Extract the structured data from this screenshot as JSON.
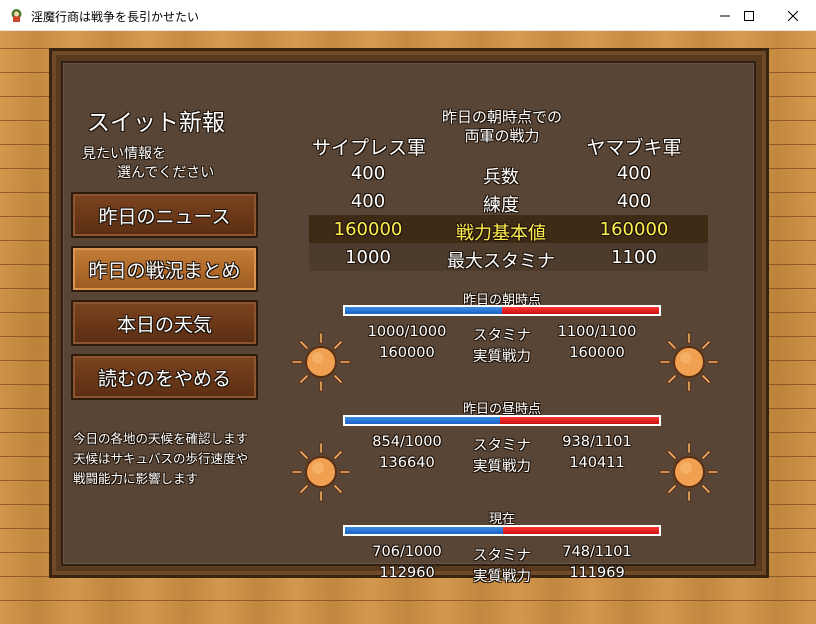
{
  "window": {
    "title": "淫魔行商は戦争を長引かせたい",
    "icon": "app-icon"
  },
  "panel": {
    "title": "スイット新報",
    "hint_line1": "見たい情報を",
    "hint_line2": "選んでください"
  },
  "menu": [
    {
      "label": "昨日のニュース",
      "active": false
    },
    {
      "label": "昨日の戦況まとめ",
      "active": true
    },
    {
      "label": "本日の天気",
      "active": false
    },
    {
      "label": "読むのをやめる",
      "active": false
    }
  ],
  "description": [
    "今日の各地の天候を確認します",
    "天候はサキュバスの歩行速度や",
    "戦闘能力に影響します"
  ],
  "comparison": {
    "header_line1": "昨日の朝時点での",
    "header_line2": "両軍の戦力",
    "left_army": "サイプレス軍",
    "right_army": "ヤマブキ軍",
    "rows": [
      {
        "label": "兵数",
        "left": "400",
        "right": "400",
        "highlight": false
      },
      {
        "label": "練度",
        "left": "400",
        "right": "400",
        "highlight": false
      },
      {
        "label": "戦力基本値",
        "left": "160000",
        "right": "160000",
        "highlight": true
      },
      {
        "label": "最大スタミナ",
        "left": "1000",
        "right": "1100",
        "highlight": false
      }
    ]
  },
  "sections": [
    {
      "label": "昨日の朝時点",
      "left_share": 0.5,
      "stamina_label": "スタミナ",
      "power_label": "実質戦力",
      "left_stamina": "1000/1000",
      "right_stamina": "1100/1100",
      "left_power": "160000",
      "right_power": "160000",
      "weather_icon": "sun-icon"
    },
    {
      "label": "昨日の昼時点",
      "left_share": 0.493,
      "stamina_label": "スタミナ",
      "power_label": "実質戦力",
      "left_stamina": "854/1000",
      "right_stamina": "938/1101",
      "left_power": "136640",
      "right_power": "140411",
      "weather_icon": "sun-icon"
    },
    {
      "label": "現在",
      "left_share": 0.502,
      "stamina_label": "スタミナ",
      "power_label": "実質戦力",
      "left_stamina": "706/1000",
      "right_stamina": "748/1101",
      "left_power": "112960",
      "right_power": "111969",
      "weather_icon": ""
    }
  ],
  "colors": {
    "highlight_text": "#ffef4d",
    "bar_left": "#2f7fdc",
    "bar_right": "#e82020",
    "sun": "#f0a050"
  }
}
